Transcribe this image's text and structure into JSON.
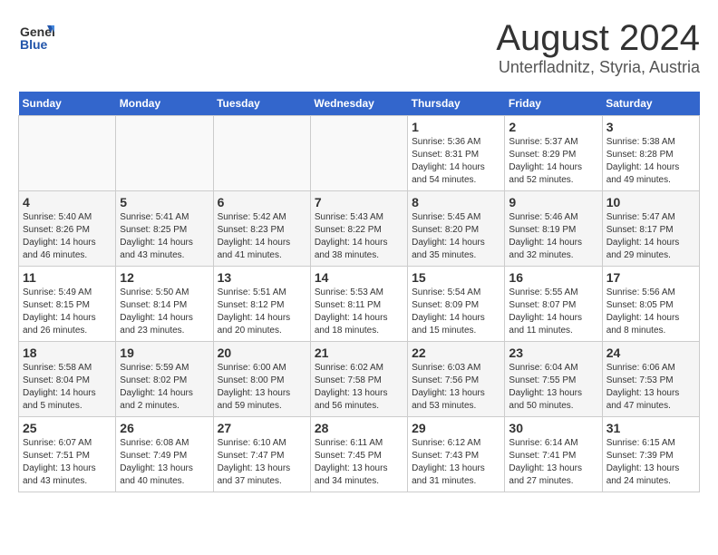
{
  "header": {
    "logo_general": "General",
    "logo_blue": "Blue",
    "month": "August 2024",
    "location": "Unterfladnitz, Styria, Austria"
  },
  "weekdays": [
    "Sunday",
    "Monday",
    "Tuesday",
    "Wednesday",
    "Thursday",
    "Friday",
    "Saturday"
  ],
  "weeks": [
    [
      {
        "day": "",
        "info": ""
      },
      {
        "day": "",
        "info": ""
      },
      {
        "day": "",
        "info": ""
      },
      {
        "day": "",
        "info": ""
      },
      {
        "day": "1",
        "info": "Sunrise: 5:36 AM\nSunset: 8:31 PM\nDaylight: 14 hours\nand 54 minutes."
      },
      {
        "day": "2",
        "info": "Sunrise: 5:37 AM\nSunset: 8:29 PM\nDaylight: 14 hours\nand 52 minutes."
      },
      {
        "day": "3",
        "info": "Sunrise: 5:38 AM\nSunset: 8:28 PM\nDaylight: 14 hours\nand 49 minutes."
      }
    ],
    [
      {
        "day": "4",
        "info": "Sunrise: 5:40 AM\nSunset: 8:26 PM\nDaylight: 14 hours\nand 46 minutes."
      },
      {
        "day": "5",
        "info": "Sunrise: 5:41 AM\nSunset: 8:25 PM\nDaylight: 14 hours\nand 43 minutes."
      },
      {
        "day": "6",
        "info": "Sunrise: 5:42 AM\nSunset: 8:23 PM\nDaylight: 14 hours\nand 41 minutes."
      },
      {
        "day": "7",
        "info": "Sunrise: 5:43 AM\nSunset: 8:22 PM\nDaylight: 14 hours\nand 38 minutes."
      },
      {
        "day": "8",
        "info": "Sunrise: 5:45 AM\nSunset: 8:20 PM\nDaylight: 14 hours\nand 35 minutes."
      },
      {
        "day": "9",
        "info": "Sunrise: 5:46 AM\nSunset: 8:19 PM\nDaylight: 14 hours\nand 32 minutes."
      },
      {
        "day": "10",
        "info": "Sunrise: 5:47 AM\nSunset: 8:17 PM\nDaylight: 14 hours\nand 29 minutes."
      }
    ],
    [
      {
        "day": "11",
        "info": "Sunrise: 5:49 AM\nSunset: 8:15 PM\nDaylight: 14 hours\nand 26 minutes."
      },
      {
        "day": "12",
        "info": "Sunrise: 5:50 AM\nSunset: 8:14 PM\nDaylight: 14 hours\nand 23 minutes."
      },
      {
        "day": "13",
        "info": "Sunrise: 5:51 AM\nSunset: 8:12 PM\nDaylight: 14 hours\nand 20 minutes."
      },
      {
        "day": "14",
        "info": "Sunrise: 5:53 AM\nSunset: 8:11 PM\nDaylight: 14 hours\nand 18 minutes."
      },
      {
        "day": "15",
        "info": "Sunrise: 5:54 AM\nSunset: 8:09 PM\nDaylight: 14 hours\nand 15 minutes."
      },
      {
        "day": "16",
        "info": "Sunrise: 5:55 AM\nSunset: 8:07 PM\nDaylight: 14 hours\nand 11 minutes."
      },
      {
        "day": "17",
        "info": "Sunrise: 5:56 AM\nSunset: 8:05 PM\nDaylight: 14 hours\nand 8 minutes."
      }
    ],
    [
      {
        "day": "18",
        "info": "Sunrise: 5:58 AM\nSunset: 8:04 PM\nDaylight: 14 hours\nand 5 minutes."
      },
      {
        "day": "19",
        "info": "Sunrise: 5:59 AM\nSunset: 8:02 PM\nDaylight: 14 hours\nand 2 minutes."
      },
      {
        "day": "20",
        "info": "Sunrise: 6:00 AM\nSunset: 8:00 PM\nDaylight: 13 hours\nand 59 minutes."
      },
      {
        "day": "21",
        "info": "Sunrise: 6:02 AM\nSunset: 7:58 PM\nDaylight: 13 hours\nand 56 minutes."
      },
      {
        "day": "22",
        "info": "Sunrise: 6:03 AM\nSunset: 7:56 PM\nDaylight: 13 hours\nand 53 minutes."
      },
      {
        "day": "23",
        "info": "Sunrise: 6:04 AM\nSunset: 7:55 PM\nDaylight: 13 hours\nand 50 minutes."
      },
      {
        "day": "24",
        "info": "Sunrise: 6:06 AM\nSunset: 7:53 PM\nDaylight: 13 hours\nand 47 minutes."
      }
    ],
    [
      {
        "day": "25",
        "info": "Sunrise: 6:07 AM\nSunset: 7:51 PM\nDaylight: 13 hours\nand 43 minutes."
      },
      {
        "day": "26",
        "info": "Sunrise: 6:08 AM\nSunset: 7:49 PM\nDaylight: 13 hours\nand 40 minutes."
      },
      {
        "day": "27",
        "info": "Sunrise: 6:10 AM\nSunset: 7:47 PM\nDaylight: 13 hours\nand 37 minutes."
      },
      {
        "day": "28",
        "info": "Sunrise: 6:11 AM\nSunset: 7:45 PM\nDaylight: 13 hours\nand 34 minutes."
      },
      {
        "day": "29",
        "info": "Sunrise: 6:12 AM\nSunset: 7:43 PM\nDaylight: 13 hours\nand 31 minutes."
      },
      {
        "day": "30",
        "info": "Sunrise: 6:14 AM\nSunset: 7:41 PM\nDaylight: 13 hours\nand 27 minutes."
      },
      {
        "day": "31",
        "info": "Sunrise: 6:15 AM\nSunset: 7:39 PM\nDaylight: 13 hours\nand 24 minutes."
      }
    ]
  ]
}
